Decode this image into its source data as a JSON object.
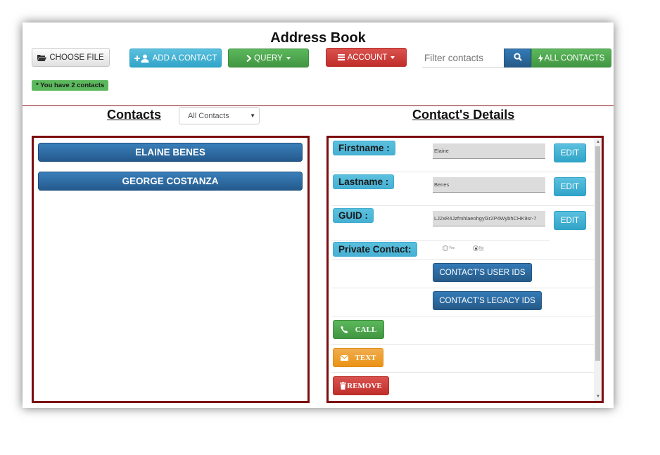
{
  "header": {
    "title": "Address Book",
    "choose_file": "CHOOSE FILE",
    "add_contact": "ADD A CONTACT",
    "query": "QUERY",
    "account": "ACCOUNT",
    "filter_placeholder": "Filter contacts",
    "all_contacts": "ALL CONTACTS",
    "contacts_count": "* You have 2 contacts"
  },
  "contacts_panel": {
    "title": "Contacts",
    "filter_select": "All Contacts",
    "items": [
      {
        "name": "ELAINE BENES"
      },
      {
        "name": "GEORGE COSTANZA"
      }
    ]
  },
  "details_panel": {
    "title": "Contact's Details",
    "fields": [
      {
        "label": "Firstname :",
        "value": "Elaine",
        "edit": "EDIT"
      },
      {
        "label": "Lastname :",
        "value": "Benes",
        "edit": "EDIT"
      },
      {
        "label": "GUID :",
        "value": "LJ2xR4Jzfmhlaeohgyl3r2P4WybhCHK9sr-7",
        "edit": "EDIT"
      }
    ],
    "private_contact": {
      "label": "Private Contact:",
      "option_yes": "Yes",
      "option_no": "No",
      "selected": "No"
    },
    "user_ids_button": "CONTACT'S USER IDS",
    "legacy_ids_button": "CONTACT'S LEGACY IDS",
    "call_button": "CALL",
    "text_button": "TEXT",
    "remove_button": "REMOVE"
  },
  "colors": {
    "panel_border": "#7b0d0d",
    "info": "#5bc0de",
    "success": "#5cb85c",
    "danger": "#d9534f",
    "primary": "#337ab7",
    "warning": "#f0ad4e"
  }
}
